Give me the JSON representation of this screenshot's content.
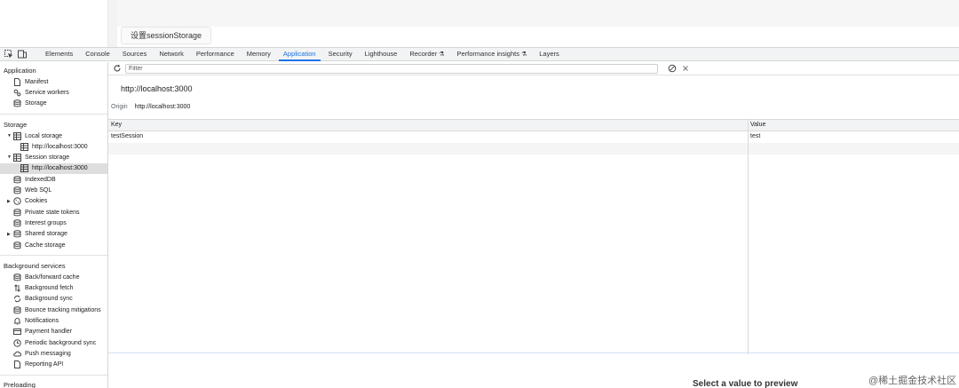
{
  "page": {
    "button_label": "设置sessionStorage"
  },
  "devtools": {
    "tabs": [
      {
        "label": "Elements"
      },
      {
        "label": "Console"
      },
      {
        "label": "Sources"
      },
      {
        "label": "Network"
      },
      {
        "label": "Performance"
      },
      {
        "label": "Memory"
      },
      {
        "label": "Application"
      },
      {
        "label": "Security"
      },
      {
        "label": "Lighthouse"
      },
      {
        "label": "Recorder"
      },
      {
        "label": "Performance insights"
      },
      {
        "label": "Layers"
      }
    ],
    "active_tab": "Application"
  },
  "sidebar": {
    "application": {
      "title": "Application",
      "items": [
        {
          "label": "Manifest",
          "icon": "file-icon"
        },
        {
          "label": "Service workers",
          "icon": "gears-icon"
        },
        {
          "label": "Storage",
          "icon": "database-icon"
        }
      ]
    },
    "storage": {
      "title": "Storage",
      "local_storage": "Local storage",
      "local_origin": "http://localhost:3000",
      "session_storage": "Session storage",
      "session_origin": "http://localhost:3000",
      "items": [
        {
          "label": "IndexedDB",
          "icon": "database-icon"
        },
        {
          "label": "Web SQL",
          "icon": "database-icon"
        },
        {
          "label": "Cookies",
          "icon": "cookie-icon"
        },
        {
          "label": "Private state tokens",
          "icon": "database-icon"
        },
        {
          "label": "Interest groups",
          "icon": "database-icon"
        },
        {
          "label": "Shared storage",
          "icon": "database-icon"
        },
        {
          "label": "Cache storage",
          "icon": "database-icon"
        }
      ]
    },
    "background": {
      "title": "Background services",
      "items": [
        {
          "label": "Back/forward cache",
          "icon": "database-icon"
        },
        {
          "label": "Background fetch",
          "icon": "arrows-icon"
        },
        {
          "label": "Background sync",
          "icon": "sync-icon"
        },
        {
          "label": "Bounce tracking mitigations",
          "icon": "database-icon"
        },
        {
          "label": "Notifications",
          "icon": "bell-icon"
        },
        {
          "label": "Payment handler",
          "icon": "card-icon"
        },
        {
          "label": "Periodic background sync",
          "icon": "clock-icon"
        },
        {
          "label": "Push messaging",
          "icon": "cloud-icon"
        },
        {
          "label": "Reporting API",
          "icon": "file-icon"
        }
      ]
    },
    "preloading_title": "Preloading"
  },
  "main": {
    "filter_placeholder": "Filter",
    "origin_title": "http://localhost:3000",
    "origin_label": "Origin",
    "origin_value": "http://localhost:3000",
    "table": {
      "headers": {
        "key": "Key",
        "value": "Value"
      },
      "rows": [
        {
          "key": "testSession",
          "value": "test"
        }
      ]
    },
    "preview_text": "Select a value to preview"
  },
  "watermark": "@稀土掘金技术社区",
  "colors": {
    "accent": "#1a73e8",
    "selected_row": "#dedede",
    "tabbar_bg": "#f1f3f4"
  }
}
